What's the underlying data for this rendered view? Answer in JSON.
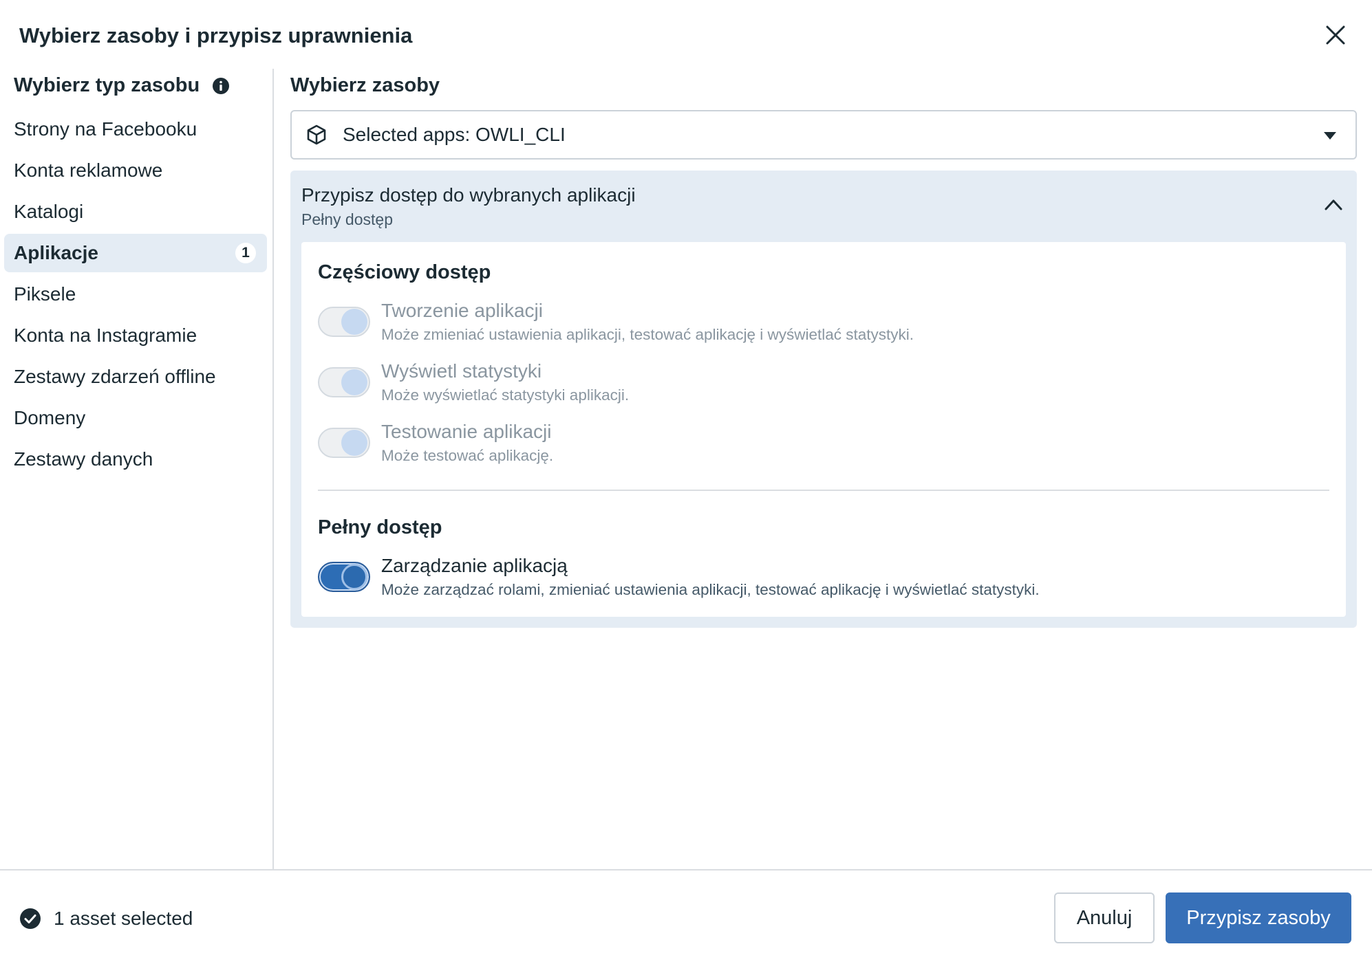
{
  "dialog": {
    "title": "Wybierz zasoby i przypisz uprawnienia"
  },
  "sidebar": {
    "heading": "Wybierz typ zasobu",
    "items": [
      {
        "label": "Strony na Facebooku"
      },
      {
        "label": "Konta reklamowe"
      },
      {
        "label": "Katalogi"
      },
      {
        "label": "Aplikacje",
        "count": "1",
        "active": true
      },
      {
        "label": "Piksele"
      },
      {
        "label": "Konta na Instagramie"
      },
      {
        "label": "Zestawy zdarzeń offline"
      },
      {
        "label": "Domeny"
      },
      {
        "label": "Zestawy danych"
      }
    ]
  },
  "main": {
    "heading": "Wybierz zasoby",
    "asset_select": {
      "value": "Selected apps: OWLI_CLI",
      "icon": "box-icon"
    },
    "access_panel": {
      "title": "Przypisz dostęp do wybranych aplikacji",
      "subtitle": "Pełny dostęp",
      "partial_section": {
        "title": "Częściowy dostęp",
        "permissions": [
          {
            "name": "Tworzenie aplikacji",
            "description": "Może zmieniać ustawienia aplikacji, testować aplikację i wyświetlać statystyki.",
            "on": true,
            "disabled": true
          },
          {
            "name": "Wyświetl statystyki",
            "description": "Może wyświetlać statystyki aplikacji.",
            "on": true,
            "disabled": true
          },
          {
            "name": "Testowanie aplikacji",
            "description": "Może testować aplikację.",
            "on": true,
            "disabled": true
          }
        ]
      },
      "full_section": {
        "title": "Pełny dostęp",
        "permissions": [
          {
            "name": "Zarządzanie aplikacją",
            "description": "Może zarządzać rolami, zmieniać ustawienia aplikacji, testować aplikację i wyświetlać statystyki.",
            "on": true,
            "disabled": false
          }
        ]
      }
    }
  },
  "footer": {
    "status": "1 asset selected",
    "cancel_label": "Anuluj",
    "primary_label": "Przypisz zasoby"
  },
  "colors": {
    "primary": "#3770b8",
    "active_nav_bg": "#e4ecf4",
    "text": "#1c2b33",
    "muted_text": "#8a96a0"
  }
}
